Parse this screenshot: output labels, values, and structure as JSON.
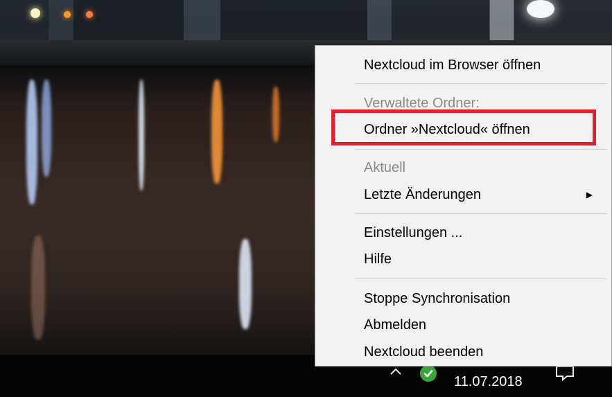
{
  "menu": {
    "open_browser": "Nextcloud im Browser öffnen",
    "managed_folders_heading": "Verwaltete Ordner:",
    "open_folder": "Ordner »Nextcloud« öffnen",
    "current_heading": "Aktuell",
    "recent_changes": "Letzte Änderungen",
    "settings": "Einstellungen ...",
    "help": "Hilfe",
    "stop_sync": "Stoppe Synchronisation",
    "logout": "Abmelden",
    "quit": "Nextcloud beenden"
  },
  "taskbar": {
    "date": "11.07.2018",
    "tray_icons": [
      "chevron-up-icon",
      "nextcloud-status-check-icon",
      "notification-icon"
    ]
  },
  "colors": {
    "highlight": "#e0202a",
    "menu_background": "#f2f2f2",
    "status_ok": "#3aa53a"
  }
}
